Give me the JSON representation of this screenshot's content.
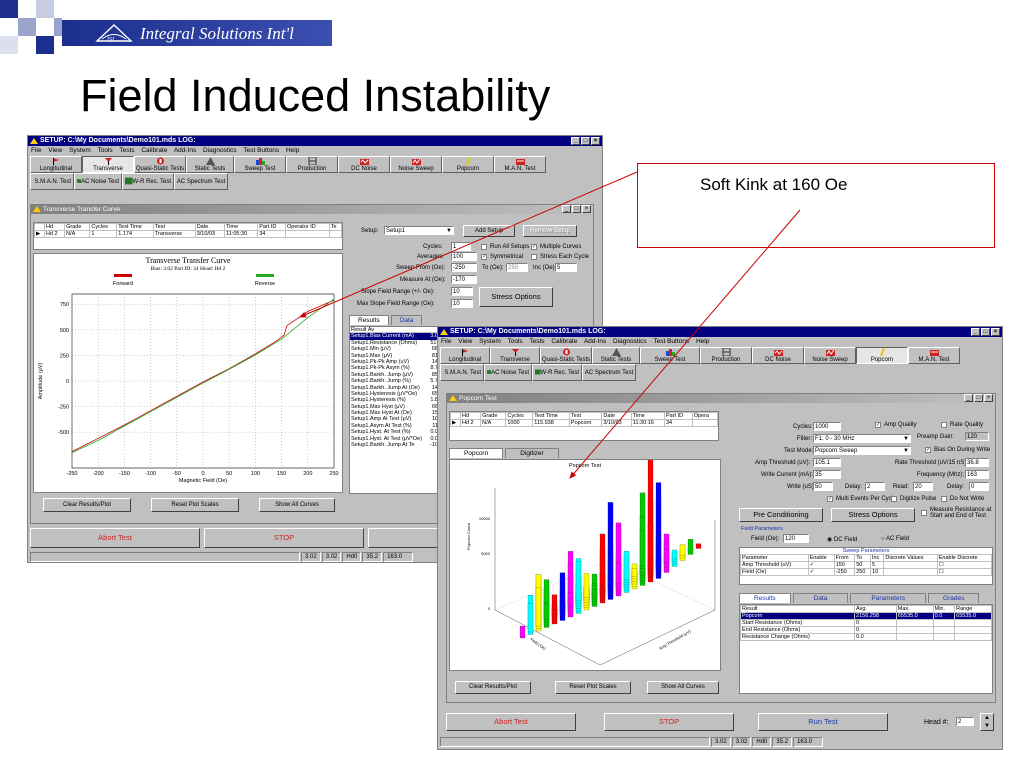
{
  "slide": {
    "company": "Integral Solutions Int'l",
    "logo_text": "ISI",
    "title": "Field Induced Instability",
    "callout": "Soft Kink at 160 Oe"
  },
  "colors": {
    "title_bar": "#000080",
    "banner": "#1c2f8e",
    "callout_border": "#cc0000",
    "forward": "#cc0000",
    "reverse": "#22aa22"
  },
  "win1": {
    "title": "SETUP:  C:\\My Documents\\Demo101.mds          LOG:",
    "menu": [
      "File",
      "View",
      "System",
      "Tools",
      "Tests",
      "Calibrate",
      "Add-Ins",
      "Diagnostics",
      "Test Buttons",
      "Help"
    ],
    "toolbar": [
      {
        "label": "Longitudinal",
        "icon": "longitudinal-icon"
      },
      {
        "label": "Transverse",
        "icon": "transverse-icon"
      },
      {
        "label": "Quasi-Static Tests",
        "icon": "quasi-static-icon"
      },
      {
        "label": "Static Tests",
        "icon": "static-icon"
      },
      {
        "label": "Sweep Test",
        "icon": "sweep-icon"
      },
      {
        "label": "Production",
        "icon": "production-icon"
      },
      {
        "label": "DC Noise",
        "icon": "dc-noise-icon"
      },
      {
        "label": "Noise Sweep",
        "icon": "noise-sweep-icon"
      },
      {
        "label": "Popcorn",
        "icon": "popcorn-icon"
      },
      {
        "label": "M.A.N. Test",
        "icon": "man-test-icon"
      }
    ],
    "toolbar2": [
      "S.M.A.N. Test",
      "AC Noise Test",
      "W-R Rec. Test",
      "AC Spectrum Test"
    ],
    "inner_title": "Transverse Transfer Curve",
    "grid_headers": [
      "Hd",
      "Grade",
      "Cycles",
      "Test Time",
      "Test",
      "Date",
      "Time",
      "Part ID",
      "Operator ID",
      "Te"
    ],
    "grid_row": [
      "Hd 2",
      "N/A",
      "1",
      "1.174",
      "Transverse",
      "3/10/03",
      "11:05:30",
      "34",
      "",
      ""
    ],
    "setup_label": "Setup:",
    "setup_value": "Setup1",
    "add_setup": "Add Setup",
    "remove_setup": "Remove Setup",
    "fields": [
      {
        "label": "Cycles:",
        "value": "1"
      },
      {
        "label": "Averages:",
        "value": "100"
      },
      {
        "label": "Sweep From (Oe):",
        "value": "-250"
      },
      {
        "label": "Measure At (Oe):",
        "value": "-170"
      },
      {
        "label": "Slope Field Range (+/- Oe):",
        "value": "10"
      },
      {
        "label": "Max Slope Field Range (Oe):",
        "value": "10"
      }
    ],
    "to_label": "To (Oe):",
    "to_value": "250",
    "inc_label": "Inc (Oe):",
    "inc_value": "5",
    "checks": [
      "Run All Setups",
      "Multiple Curves",
      "Symmetrical",
      "Stress Each Cycle"
    ],
    "stress_options": "Stress Options",
    "tabs": [
      "Results",
      "Data"
    ],
    "results_header": [
      "Result",
      "Av"
    ],
    "results": [
      "Setup1.Bias Current (mA)",
      "Setup1.Resistance (Ohms)",
      "Setup1.Min (μV)",
      "Setup1.Max (μV)",
      "Setup1.Pk-Pk Amp (uV)",
      "Setup1.Pk-Pk Asym (%)",
      "Setup1.Barkh. Jump (μV)",
      "Setup1.Barkh. Jump (%)",
      "Setup1.Barkh. Jump At (Oe)",
      "Setup1.Hysteresis (μV*Oe)",
      "Setup1.Hysteresis (%)",
      "Setup1.Max Hyst (μV)",
      "Setup1.Max Hyst At (Oe)",
      "Setup1.Amp At Test (μV)",
      "Setup1.Asym At Test (%)",
      "Setup1.Hyst. At Test (%)",
      "Setup1.Hyst. At Test (μV*Oe)",
      "Setup1.Barkh. Jump At Te"
    ],
    "results_vals": [
      "3.0",
      "51.",
      "68",
      "81",
      "14",
      "8.7",
      "85",
      "5.7",
      "14",
      "65",
      "1.8",
      "66",
      "15",
      "10",
      "11",
      "0.0",
      "0.0",
      "-10"
    ],
    "buttons": [
      "Clear Results/Plot",
      "Reset Plot Scales",
      "Show All Curves"
    ],
    "abort": "Abort Test",
    "stop": "STOP",
    "run": "Run Test",
    "status": [
      "3.02",
      "3.02",
      "Hd0",
      "35.2",
      "163.0"
    ]
  },
  "chart_data": {
    "type": "line",
    "title": "Transverse Transfer Curve",
    "subtitle": "Bias: 3.02 Part ID: 34 Head: Hd 2",
    "xlabel": "Magnetic Field (Oe)",
    "ylabel": "Amplitude (μV)",
    "xlim": [
      -250,
      250
    ],
    "ylim": [
      -850,
      850
    ],
    "xticks": [
      -250,
      -200,
      -150,
      -100,
      -50,
      0,
      50,
      100,
      150,
      200,
      250
    ],
    "yticks": [
      750,
      500,
      250,
      0,
      -250,
      -500
    ],
    "legend": "top",
    "grid": true,
    "series": [
      {
        "name": "Forward",
        "color": "#cc0000",
        "x": [
          -250,
          -200,
          -150,
          -100,
          -50,
          0,
          50,
          100,
          140,
          155,
          160,
          170,
          200,
          250
        ],
        "y": [
          -690,
          -560,
          -430,
          -290,
          -150,
          -10,
          120,
          265,
          390,
          450,
          540,
          575,
          680,
          790
        ]
      },
      {
        "name": "Reverse",
        "color": "#22aa22",
        "x": [
          -250,
          -200,
          -150,
          -100,
          -50,
          0,
          50,
          100,
          150,
          200,
          250
        ],
        "y": [
          -700,
          -580,
          -440,
          -300,
          -160,
          -20,
          115,
          255,
          410,
          620,
          800
        ]
      }
    ]
  },
  "win2": {
    "title": "SETUP:  C:\\My Documents\\Demo101.mds          LOG:",
    "menu": [
      "File",
      "View",
      "System",
      "Tools",
      "Tests",
      "Calibrate",
      "Add-Ins",
      "Diagnostics",
      "Test Buttons",
      "Help"
    ],
    "inner_title": "Popcorn Test",
    "grid_headers": [
      "Hd",
      "Grade",
      "Cycles",
      "Test Time",
      "Test",
      "Date",
      "Time",
      "Part ID",
      "Opera"
    ],
    "grid_row": [
      "Hd 2",
      "N/A",
      "1000",
      "115.938",
      "Popcorn",
      "3/10/03",
      "11:30:16",
      "34",
      ""
    ],
    "plot_tabs": [
      "Popcorn",
      "Digitizer"
    ],
    "plot_title": "Popcorn Test",
    "plot_axis": [
      "Popcorn Count",
      "Field (Oe)",
      "Amp Threshold (μV)"
    ],
    "plot_ticks": [
      "10000",
      "5000",
      "0"
    ],
    "cycles_label": "Cycles:",
    "cycles": "1000",
    "amp_quality": "Amp Quality",
    "rate_quality": "Rate Quality",
    "filter_label": "Filter:",
    "filter": "F1:   0 - 30 MHz",
    "preamp_label": "Preamp Gain:",
    "preamp": "120",
    "mode_label": "Test Mode:",
    "mode": "Popcorn Sweep",
    "bias_on": "Bias On During Write",
    "amp_thr_label": "Amp Threshold (uV):",
    "amp_thr": "105.1",
    "rate_thr_label": "Rate Threshold (uV/15 nS):",
    "rate_thr": "36.8",
    "write_cur_label": "Write Current (mA):",
    "write_cur": "35",
    "freq_label": "Frequency (Mhz):",
    "freq": "163",
    "write_label": "Write (uS):",
    "write": "50",
    "delay_label": "Delay:",
    "delay": "2",
    "read_label": "Read:",
    "read": "20",
    "delay2_label": "Delay:",
    "delay2": "0",
    "multi_events": "Multi Events Per Cycle",
    "digitize_pulse": "Digitize Pulse",
    "do_not_write": "Do Not Write",
    "pre_cond": "Pre Conditioning",
    "stress_opts": "Stress Options",
    "measure_res": "Measure Resistance at Start and End of Test",
    "field_params": "Field Parameters",
    "field_label": "Field (Oe):",
    "field": "120",
    "dc_field": "DC Field",
    "ac_field": "AC Field",
    "sweep_params": "Sweep Parameters",
    "sweep_headers": [
      "Parameter",
      "Enable",
      "From",
      "To",
      "Inc",
      "Discrete Values",
      "Enable Discrete"
    ],
    "sweep_rows": [
      [
        "Amp Threshold (uV)",
        "✓",
        "150",
        "50",
        "5",
        "",
        ""
      ],
      [
        "Field (Oe)",
        "✓",
        "-250",
        "250",
        "10",
        "",
        ""
      ]
    ],
    "result_tabs": [
      "Results",
      "Data",
      "Parameters",
      "Grades"
    ],
    "result_headers": [
      "Result",
      "Avg.",
      "Max.",
      "Min.",
      "Range"
    ],
    "result_rows": [
      [
        "Popcorn",
        "2156.258",
        "65535.0",
        "0.0",
        "65535.0"
      ],
      [
        "Start Resistance (Ohms)",
        "0",
        "",
        "",
        ""
      ],
      [
        "End Resistance (Ohms)",
        "0",
        "",
        "",
        ""
      ],
      [
        "Resistance Change (Ohms)",
        "0.0",
        "",
        "",
        ""
      ]
    ],
    "buttons": [
      "Clear Results/Plot",
      "Reset Plot Scales",
      "Show All Curves"
    ],
    "abort": "Abort Test",
    "stop": "STOP",
    "run": "Run Test",
    "head_label": "Head #:",
    "head": "2",
    "status": [
      "3.02",
      "3.02",
      "Hd0",
      "35.2",
      "163.0"
    ]
  }
}
